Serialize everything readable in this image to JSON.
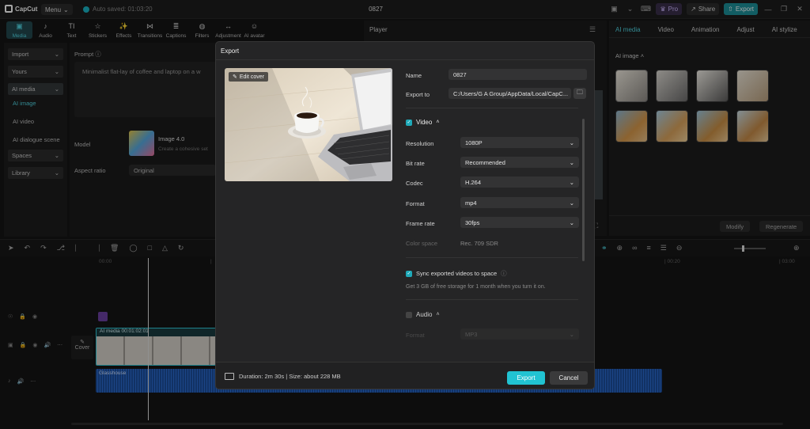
{
  "app": {
    "logo": "CapCut",
    "menu": "Menu",
    "autosave": "Auto saved: 01:03:20",
    "project_title": "0827"
  },
  "topbar": {
    "pro": "Pro",
    "share": "Share",
    "export": "Export"
  },
  "tools": [
    "Media",
    "Audio",
    "Text",
    "Stickers",
    "Effects",
    "Transitions",
    "Captions",
    "Filters",
    "Adjustment",
    "AI avatar"
  ],
  "tool_icons": [
    "▣",
    "♪",
    "TI",
    "☆",
    "✨",
    "⋈",
    "≣",
    "◍",
    "↔",
    "☺"
  ],
  "left_nav": {
    "import": "Import",
    "yours": "Yours",
    "ai_media": "AI media",
    "sub": [
      "AI image",
      "AI video",
      "AI dialogue scene"
    ],
    "spaces": "Spaces",
    "library": "Library"
  },
  "mid": {
    "prompt_label": "Prompt",
    "prompt_text": "Minimalist flat-lay of coffee and laptop on a w",
    "model_label": "Model",
    "model_name": "Image 4.0",
    "model_desc": "Create a cohesive set",
    "aspect_label": "Aspect ratio",
    "aspect_value": "Original"
  },
  "player": {
    "title": "Player"
  },
  "right": {
    "tabs": [
      "AI media",
      "Video",
      "Animation",
      "Adjust",
      "AI stylize"
    ],
    "section": "AI image",
    "modify": "Modify",
    "regenerate": "Regenerate"
  },
  "timeline": {
    "ticks": [
      "00:00",
      "|",
      "| 00:20",
      "| 03:00"
    ],
    "cover_label": "Cover",
    "clip_label": "AI media  00:01:02:01",
    "audio_label": "Glasshouse"
  },
  "export": {
    "title": "Export",
    "edit_cover": "Edit cover",
    "name_label": "Name",
    "name_value": "0827",
    "export_to_label": "Export to",
    "export_to_value": "C:/Users/G A Group/AppData/Local/CapC...",
    "video_section": "Video",
    "resolution_label": "Resolution",
    "resolution_value": "1080P",
    "bitrate_label": "Bit rate",
    "bitrate_value": "Recommended",
    "codec_label": "Codec",
    "codec_value": "H.264",
    "format_label": "Format",
    "format_value": "mp4",
    "framerate_label": "Frame rate",
    "framerate_value": "30fps",
    "colorspace_label": "Color space",
    "colorspace_value": "Rec. 709 SDR",
    "sync_label": "Sync exported videos to space",
    "sync_note": "Get 3 GB of free storage for 1 month when you turn it on.",
    "audio_section": "Audio",
    "audio_format_label": "Format",
    "audio_format_value": "MP3",
    "footer_info": "Duration: 2m 30s | Size: about 228 MB",
    "export_btn": "Export",
    "cancel_btn": "Cancel"
  },
  "colors": {
    "accent": "#21c3d2",
    "accent_dark": "#1c8f99",
    "panel": "#252526"
  }
}
